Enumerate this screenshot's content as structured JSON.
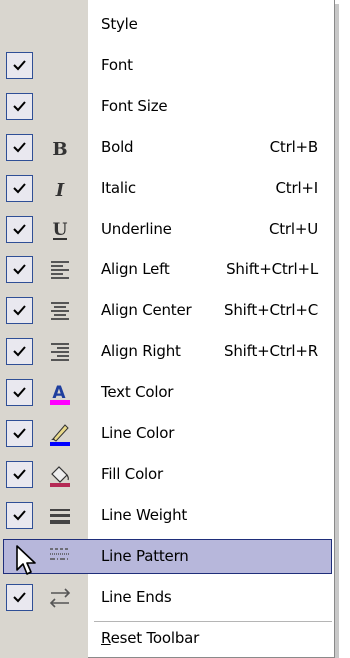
{
  "menu": {
    "items": [
      {
        "label": "Style",
        "checked": false,
        "icon": "none",
        "shortcut": ""
      },
      {
        "label": "Font",
        "checked": true,
        "icon": "none",
        "shortcut": ""
      },
      {
        "label": "Font Size",
        "checked": true,
        "icon": "none",
        "shortcut": ""
      },
      {
        "label": "Bold",
        "checked": true,
        "icon": "bold-icon",
        "shortcut": "Ctrl+B"
      },
      {
        "label": "Italic",
        "checked": true,
        "icon": "italic-icon",
        "shortcut": "Ctrl+I"
      },
      {
        "label": "Underline",
        "checked": true,
        "icon": "underline-icon",
        "shortcut": "Ctrl+U"
      },
      {
        "label": "Align Left",
        "checked": true,
        "icon": "align-left-icon",
        "shortcut": "Shift+Ctrl+L"
      },
      {
        "label": "Align Center",
        "checked": true,
        "icon": "align-center-icon",
        "shortcut": "Shift+Ctrl+C"
      },
      {
        "label": "Align Right",
        "checked": true,
        "icon": "align-right-icon",
        "shortcut": "Shift+Ctrl+R"
      },
      {
        "label": "Text Color",
        "checked": true,
        "icon": "text-color-icon",
        "shortcut": ""
      },
      {
        "label": "Line Color",
        "checked": true,
        "icon": "line-color-icon",
        "shortcut": ""
      },
      {
        "label": "Fill Color",
        "checked": true,
        "icon": "fill-color-icon",
        "shortcut": ""
      },
      {
        "label": "Line Weight",
        "checked": true,
        "icon": "line-weight-icon",
        "shortcut": ""
      },
      {
        "label": "Line Pattern",
        "checked": false,
        "icon": "line-pattern-icon",
        "shortcut": "",
        "highlighted": true
      },
      {
        "label": "Line Ends",
        "checked": true,
        "icon": "line-ends-icon",
        "shortcut": ""
      }
    ],
    "reset": {
      "first_letter": "R",
      "rest": "eset Toolbar"
    }
  },
  "colors": {
    "gutter": "#d9d6cf",
    "highlight": "#b7b7db",
    "highlight_border": "#1f2e7a",
    "check_border": "#2f4f96",
    "text_color_swatch": "#ff00ff",
    "line_color_swatch": "#0000ff",
    "fill_color_swatch": "#b52a55"
  }
}
